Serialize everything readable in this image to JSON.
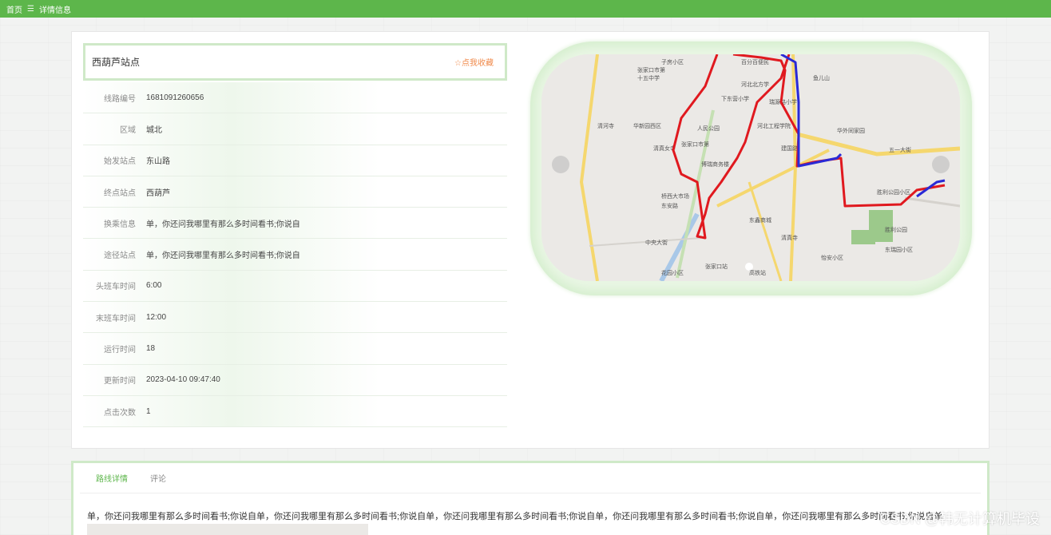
{
  "breadcrumb": {
    "home": "首页",
    "separator": "☰",
    "current": "详情信息"
  },
  "station": {
    "title": "西葫芦站点",
    "favorite_label": "☆点我收藏"
  },
  "details": [
    {
      "key": "线路编号",
      "value": "1681091260656"
    },
    {
      "key": "区域",
      "value": "城北"
    },
    {
      "key": "始发站点",
      "value": "东山路"
    },
    {
      "key": "终点站点",
      "value": "西葫芦"
    },
    {
      "key": "换乘信息",
      "value": "单，你还问我哪里有那么多时间看书;你说自"
    },
    {
      "key": "途径站点",
      "value": "单，你还问我哪里有那么多时间看书;你说自"
    },
    {
      "key": "头班车时间",
      "value": "6:00"
    },
    {
      "key": "末班车时间",
      "value": "12:00"
    },
    {
      "key": "运行时间",
      "value": "18"
    },
    {
      "key": "更新时间",
      "value": "2023-04-10 09:47:40"
    },
    {
      "key": "点击次数",
      "value": "1"
    }
  ],
  "map": {
    "labels": [
      "子房小区",
      "百分百便民",
      "张家口市第",
      "十五中学",
      "河北北方学",
      "鱼儿山",
      "下东营小学",
      "瑞源路小学",
      "清河寺",
      "华新园西区",
      "人民公园",
      "河北工程学院",
      "华外同家园",
      "清真女寺",
      "张家口市第",
      "博瑞商务楼",
      "建国路",
      "桥西大市场",
      "东安路",
      "东鑫商城",
      "清真寺",
      "胜利公园小区",
      "胜利公园",
      "东瑞园小区",
      "中央大街",
      "张家口站",
      "花园小区",
      "怡安小区",
      "高铁站",
      "五一大街"
    ],
    "route_color_main": "#e0191f",
    "route_color_alt": "#2a2ad6"
  },
  "tabs": {
    "detail": "路线详情",
    "comment": "评论"
  },
  "description": "单，你还问我哪里有那么多时间看书;你说自单，你还问我哪里有那么多时间看书;你说自单，你还问我哪里有那么多时间看书;你说自单，你还问我哪里有那么多时间看书;你说自单，你还问我哪里有那么多时间看书;你说自单",
  "watermark": "CSDN @韩无计算机毕设",
  "colors": {
    "accent": "#5db64b",
    "favorite": "#f08a4b"
  }
}
